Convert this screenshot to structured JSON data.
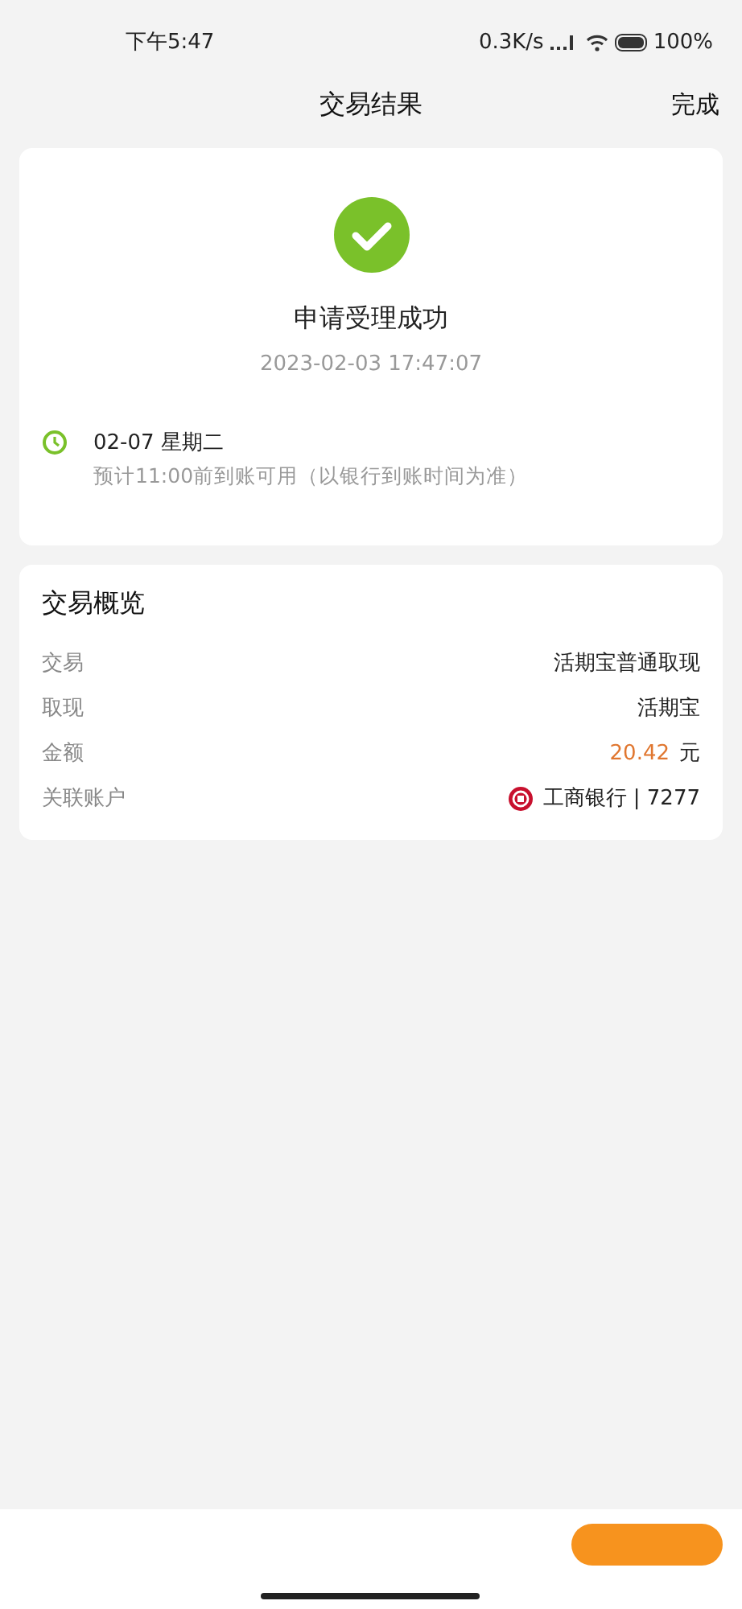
{
  "status_bar": {
    "time": "下午5:47",
    "speed": "0.3K/s",
    "battery": "100%"
  },
  "nav": {
    "title": "交易结果",
    "action": "完成"
  },
  "result": {
    "title": "申请受理成功",
    "datetime": "2023-02-03 17:47:07",
    "arrival_date": "02-07 星期二",
    "arrival_note": "预计11:00前到账可用（以银行到账时间为准）"
  },
  "overview": {
    "title": "交易概览",
    "rows": [
      {
        "kind": "text",
        "label": "交易",
        "value": "活期宝普通取现"
      },
      {
        "kind": "text",
        "label": "取现",
        "value": "活期宝"
      },
      {
        "kind": "amount",
        "label": "金额",
        "value": "20.42",
        "unit": "元"
      },
      {
        "kind": "bank",
        "label": "关联账户",
        "value": "工商银行 | 7277"
      }
    ]
  }
}
